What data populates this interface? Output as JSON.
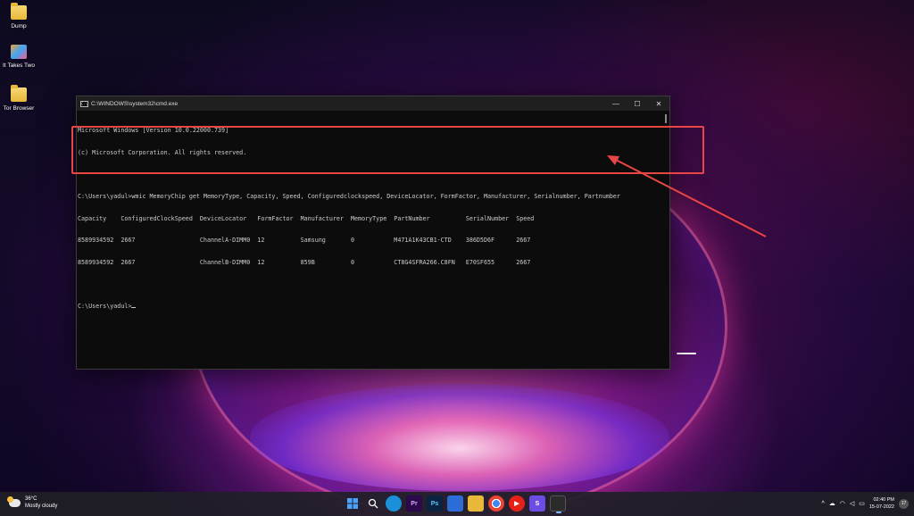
{
  "desktop": {
    "icons": [
      {
        "label": "Dump",
        "icon": "folder-icon"
      },
      {
        "label": "It Takes Two",
        "icon": "game-icon"
      },
      {
        "label": "Tor Browser",
        "icon": "folder-icon"
      }
    ]
  },
  "cmd_window": {
    "title": "C:\\WINDOWS\\system32\\cmd.exe",
    "controls": {
      "minimize": "—",
      "maximize": "☐",
      "close": "✕"
    },
    "lines": [
      "Microsoft Windows [Version 10.0.22000.739]",
      "(c) Microsoft Corporation. All rights reserved.",
      "",
      "C:\\Users\\yadul>wmic MemoryChip get MemoryType, Capacity, Speed, Configuredclockspeed, DeviceLocator, FormFactor, Manufacturer, Serialnumber, Partnumber",
      "Capacity    ConfiguredClockSpeed  DeviceLocator   FormFactor  Manufacturer  MemoryType  PartNumber          SerialNumber  Speed",
      "8589934592  2667                  ChannelA-DIMM0  12          Samsung       0           M471A1K43CB1-CTD    386D5D6F      2667",
      "8589934592  2667                  ChannelB-DIMM0  12          859B          0           CT8G4SFRA266.C8FN   E70SF655      2667",
      "",
      "C:\\Users\\yadul>"
    ]
  },
  "taskbar": {
    "weather": {
      "temp": "36°C",
      "condition": "Mostly cloudy",
      "icon": "partly-cloudy-icon"
    },
    "apps": [
      {
        "name": "windows-start-icon",
        "label": "",
        "color": "#4aa3ff"
      },
      {
        "name": "search-icon",
        "label": "⌕",
        "color": "transparent"
      },
      {
        "name": "edge-icon",
        "label": "e",
        "color": "#1b8fd8"
      },
      {
        "name": "premiere-icon",
        "label": "Pr",
        "color": "#2a0a4a"
      },
      {
        "name": "photoshop-icon",
        "label": "Ps",
        "color": "#0a2340"
      },
      {
        "name": "store-icon",
        "label": "▣",
        "color": "#2b6cd6"
      },
      {
        "name": "file-explorer-icon",
        "label": "▬",
        "color": "#e8b83a"
      },
      {
        "name": "chrome-icon",
        "label": "●",
        "color": "#d9d9d9"
      },
      {
        "name": "youtube-music-icon",
        "label": "▶",
        "color": "#e62117"
      },
      {
        "name": "app-s-icon",
        "label": "S",
        "color": "#6b4de6"
      },
      {
        "name": "terminal-icon",
        "label": ">_",
        "color": "#2b2b2b"
      }
    ],
    "tray": {
      "chevron": "^",
      "time": "02:40 PM",
      "date": "15-07-2022",
      "notifications": "17"
    }
  }
}
